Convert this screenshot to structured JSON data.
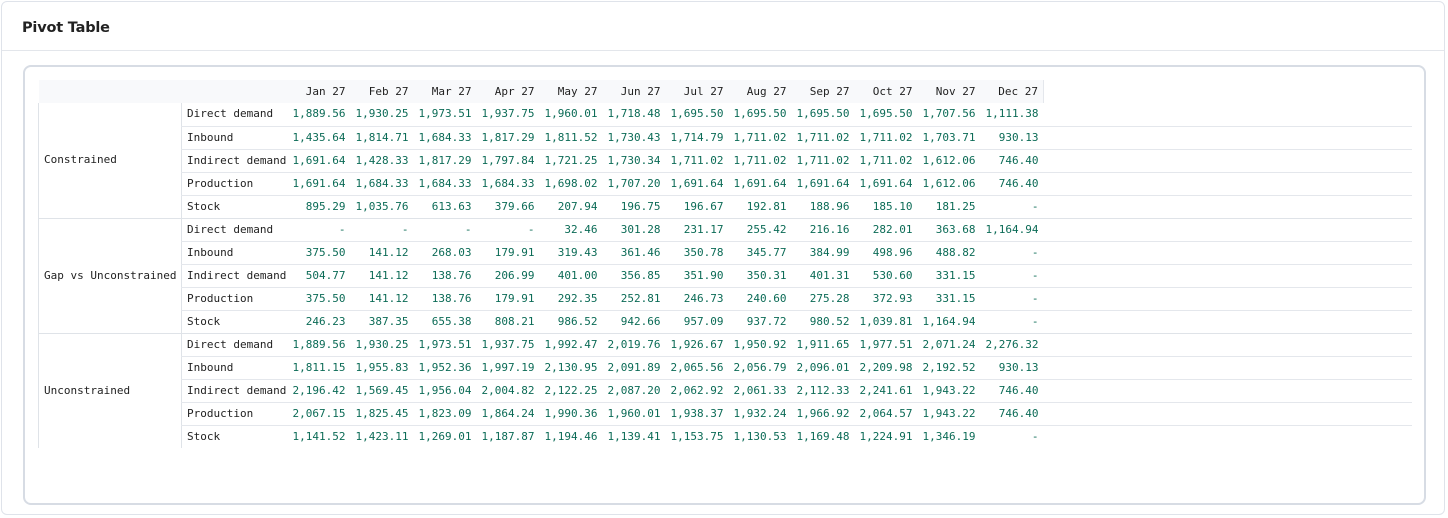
{
  "card": {
    "title": "Pivot Table"
  },
  "pivot": {
    "months": [
      "Jan 27",
      "Feb 27",
      "Mar 27",
      "Apr 27",
      "May 27",
      "Jun 27",
      "Jul 27",
      "Aug 27",
      "Sep 27",
      "Oct 27",
      "Nov 27",
      "Dec 27"
    ],
    "groups": [
      {
        "label": "Constrained",
        "rows": [
          {
            "measure": "Direct demand",
            "values": [
              "1,889.56",
              "1,930.25",
              "1,973.51",
              "1,937.75",
              "1,960.01",
              "1,718.48",
              "1,695.50",
              "1,695.50",
              "1,695.50",
              "1,695.50",
              "1,707.56",
              "1,111.38"
            ]
          },
          {
            "measure": "Inbound",
            "values": [
              "1,435.64",
              "1,814.71",
              "1,684.33",
              "1,817.29",
              "1,811.52",
              "1,730.43",
              "1,714.79",
              "1,711.02",
              "1,711.02",
              "1,711.02",
              "1,703.71",
              "930.13"
            ]
          },
          {
            "measure": "Indirect demand",
            "values": [
              "1,691.64",
              "1,428.33",
              "1,817.29",
              "1,797.84",
              "1,721.25",
              "1,730.34",
              "1,711.02",
              "1,711.02",
              "1,711.02",
              "1,711.02",
              "1,612.06",
              "746.40"
            ]
          },
          {
            "measure": "Production",
            "values": [
              "1,691.64",
              "1,684.33",
              "1,684.33",
              "1,684.33",
              "1,698.02",
              "1,707.20",
              "1,691.64",
              "1,691.64",
              "1,691.64",
              "1,691.64",
              "1,612.06",
              "746.40"
            ]
          },
          {
            "measure": "Stock",
            "values": [
              "895.29",
              "1,035.76",
              "613.63",
              "379.66",
              "207.94",
              "196.75",
              "196.67",
              "192.81",
              "188.96",
              "185.10",
              "181.25",
              "-"
            ]
          }
        ]
      },
      {
        "label": "Gap vs Unconstrained",
        "rows": [
          {
            "measure": "Direct demand",
            "values": [
              "-",
              "-",
              "-",
              "-",
              "32.46",
              "301.28",
              "231.17",
              "255.42",
              "216.16",
              "282.01",
              "363.68",
              "1,164.94"
            ]
          },
          {
            "measure": "Inbound",
            "values": [
              "375.50",
              "141.12",
              "268.03",
              "179.91",
              "319.43",
              "361.46",
              "350.78",
              "345.77",
              "384.99",
              "498.96",
              "488.82",
              "-"
            ]
          },
          {
            "measure": "Indirect demand",
            "values": [
              "504.77",
              "141.12",
              "138.76",
              "206.99",
              "401.00",
              "356.85",
              "351.90",
              "350.31",
              "401.31",
              "530.60",
              "331.15",
              "-"
            ]
          },
          {
            "measure": "Production",
            "values": [
              "375.50",
              "141.12",
              "138.76",
              "179.91",
              "292.35",
              "252.81",
              "246.73",
              "240.60",
              "275.28",
              "372.93",
              "331.15",
              "-"
            ]
          },
          {
            "measure": "Stock",
            "values": [
              "246.23",
              "387.35",
              "655.38",
              "808.21",
              "986.52",
              "942.66",
              "957.09",
              "937.72",
              "980.52",
              "1,039.81",
              "1,164.94",
              "-"
            ]
          }
        ]
      },
      {
        "label": "Unconstrained",
        "rows": [
          {
            "measure": "Direct demand",
            "values": [
              "1,889.56",
              "1,930.25",
              "1,973.51",
              "1,937.75",
              "1,992.47",
              "2,019.76",
              "1,926.67",
              "1,950.92",
              "1,911.65",
              "1,977.51",
              "2,071.24",
              "2,276.32"
            ]
          },
          {
            "measure": "Inbound",
            "values": [
              "1,811.15",
              "1,955.83",
              "1,952.36",
              "1,997.19",
              "2,130.95",
              "2,091.89",
              "2,065.56",
              "2,056.79",
              "2,096.01",
              "2,209.98",
              "2,192.52",
              "930.13"
            ]
          },
          {
            "measure": "Indirect demand",
            "values": [
              "2,196.42",
              "1,569.45",
              "1,956.04",
              "2,004.82",
              "2,122.25",
              "2,087.20",
              "2,062.92",
              "2,061.33",
              "2,112.33",
              "2,241.61",
              "1,943.22",
              "746.40"
            ]
          },
          {
            "measure": "Production",
            "values": [
              "2,067.15",
              "1,825.45",
              "1,823.09",
              "1,864.24",
              "1,990.36",
              "1,960.01",
              "1,938.37",
              "1,932.24",
              "1,966.92",
              "2,064.57",
              "1,943.22",
              "746.40"
            ]
          },
          {
            "measure": "Stock",
            "values": [
              "1,141.52",
              "1,423.11",
              "1,269.01",
              "1,187.87",
              "1,194.46",
              "1,139.41",
              "1,153.75",
              "1,130.53",
              "1,169.48",
              "1,224.91",
              "1,346.19",
              "-"
            ]
          }
        ]
      }
    ]
  }
}
